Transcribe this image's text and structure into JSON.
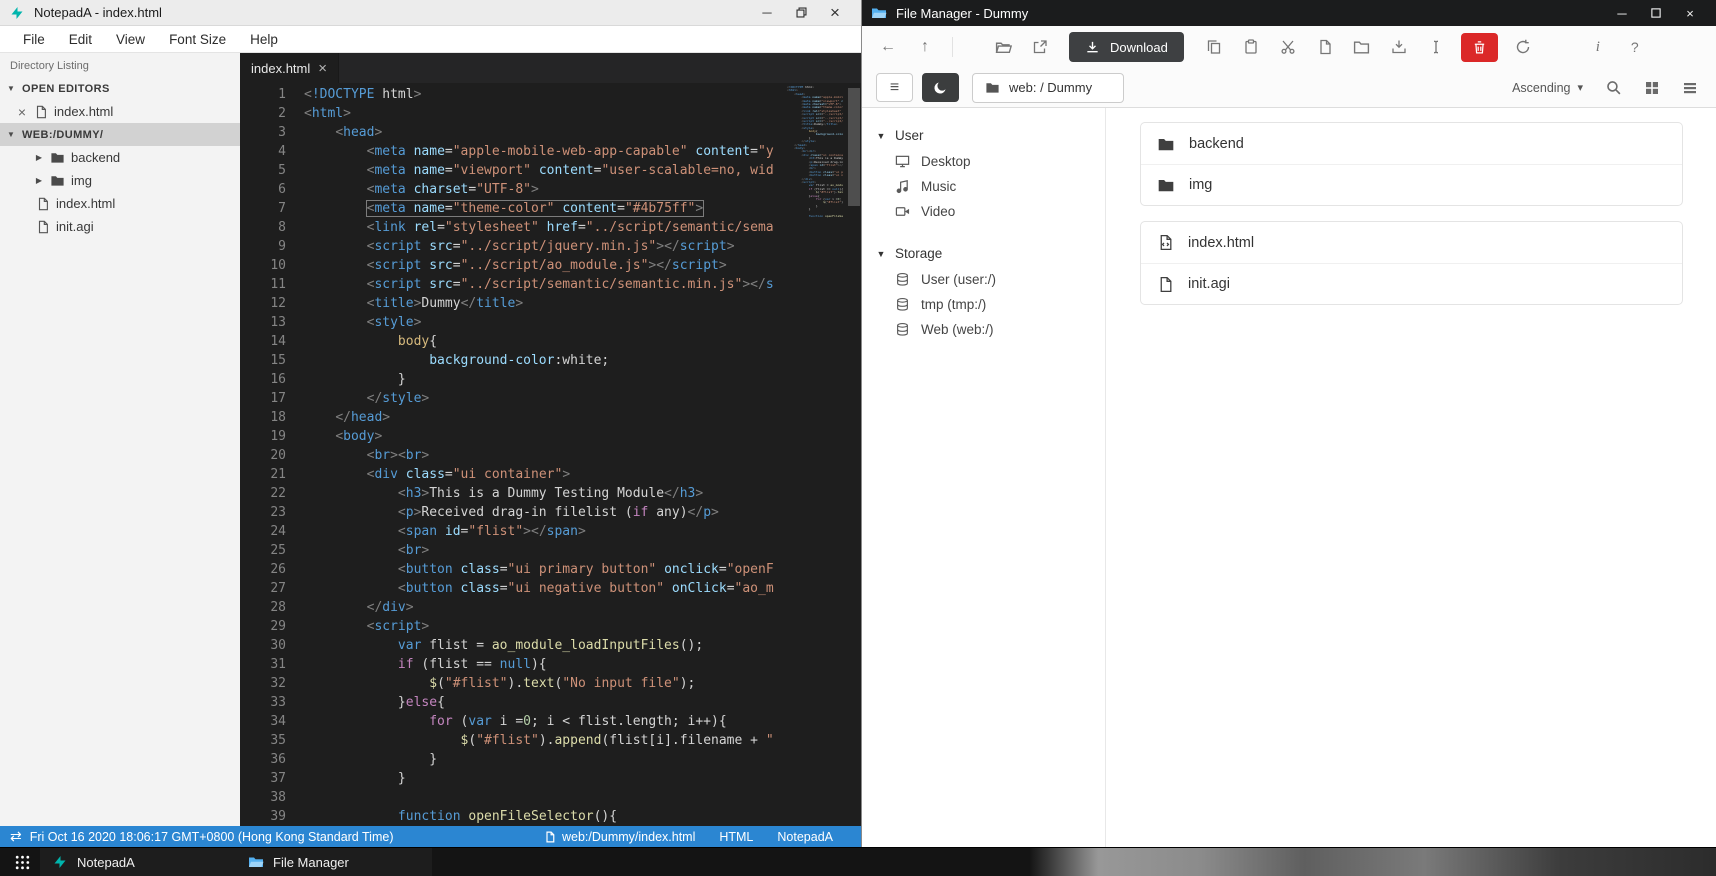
{
  "glyphs": {
    "back": "←",
    "up": "↑",
    "minimize": "─",
    "close": "×",
    "swap": "⇄",
    "caret_down": "▼",
    "caret_right": "▶",
    "caret_small": "▾",
    "info": "i",
    "help": "?",
    "hamburger": "≡"
  },
  "notepada": {
    "title": "NotepadA - index.html",
    "menu": [
      "File",
      "Edit",
      "View",
      "Font Size",
      "Help"
    ],
    "explorer": {
      "heading": "Directory Listing",
      "open_editors_label": "OPEN EDITORS",
      "open_editor_file": "index.html",
      "workspace_label": "WEB:/DUMMY/",
      "folders": [
        "backend",
        "img"
      ],
      "files": [
        "index.html",
        "init.agi"
      ]
    },
    "tab": "index.html",
    "editor": {
      "active_line": 7,
      "lines": [
        "<!DOCTYPE html>",
        "<html>",
        "    <head>",
        "        <meta name=\"apple-mobile-web-app-capable\" content=\"yes\">",
        "        <meta name=\"viewport\" content=\"user-scalable=no, width=device-width, initial-scale=1\">",
        "        <meta charset=\"UTF-8\">",
        "        <meta name=\"theme-color\" content=\"#4b75ff\">",
        "        <link rel=\"stylesheet\" href=\"../script/semantic/semantic.min.css\">",
        "        <script src=\"../script/jquery.min.js\"></script>",
        "        <script src=\"../script/ao_module.js\"></script>",
        "        <script src=\"../script/semantic/semantic.min.js\"></script>",
        "        <title>Dummy</title>",
        "        <style>",
        "            body{",
        "                background-color:white;",
        "            }",
        "        </style>",
        "    </head>",
        "    <body>",
        "        <br><br>",
        "        <div class=\"ui container\">",
        "            <h3>This is a Dummy Testing Module</h3>",
        "            <p>Received drag-in filelist (if any)</p>",
        "            <span id=\"flist\"></span>",
        "            <br>",
        "            <button class=\"ui primary button\" onclick=\"openFileSelector();\">Open File Selector</button>",
        "            <button class=\"ui negative button\" onClick=\"ao_module_close();\">Close Module</button>",
        "        </div>",
        "        <script>",
        "            var flist = ao_module_loadInputFiles();",
        "            if (flist == null){",
        "                $(\"#flist\").text(\"No input file\");",
        "            }else{",
        "                for (var i =0; i < flist.length; i++){",
        "                    $(\"#flist\").append(flist[i].filename + \"<br>\");",
        "                }",
        "            }",
        "",
        "            function openFileSelector(){"
      ]
    },
    "status": {
      "datetime": "Fri Oct 16 2020 18:06:17 GMT+0800 (Hong Kong Standard Time)",
      "path": "web:/Dummy/index.html",
      "language": "HTML",
      "app": "NotepadA"
    }
  },
  "filemanager": {
    "title": "File Manager - Dummy",
    "toolbar": {
      "download": "Download",
      "path": "web: / Dummy",
      "sort": "Ascending"
    },
    "sidebar": {
      "user_label": "User",
      "user_items": [
        "Desktop",
        "Music",
        "Video"
      ],
      "storage_label": "Storage",
      "storage_items": [
        "User (user:/)",
        "tmp (tmp:/)",
        "Web (web:/)"
      ]
    },
    "folders": [
      "backend",
      "img"
    ],
    "files": [
      "index.html",
      "init.agi"
    ]
  },
  "taskbar": {
    "apps": [
      "NotepadA",
      "File Manager"
    ]
  }
}
